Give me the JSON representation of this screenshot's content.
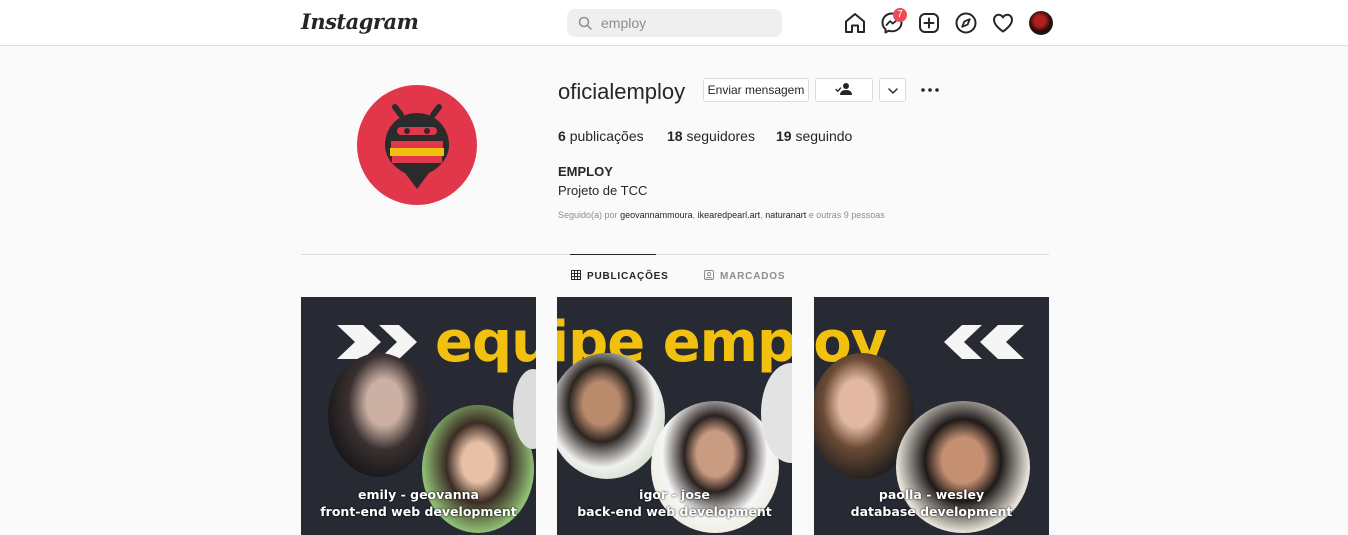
{
  "nav": {
    "logo": "Instagram",
    "search_value": "employ",
    "messenger_badge": "7",
    "icons": [
      "home-icon",
      "messenger-icon",
      "new-post-icon",
      "explore-icon",
      "activity-heart-icon",
      "profile-avatar"
    ]
  },
  "profile": {
    "username": "oficialemploy",
    "message_button": "Enviar mensagem",
    "posts_count": "6",
    "posts_label": "publicações",
    "followers_count": "18",
    "followers_label": "seguidores",
    "following_count": "19",
    "following_label": "seguindo",
    "full_name": "EMPLOY",
    "bio": "Projeto de TCC",
    "followed_by_prefix": "Seguido(a) por",
    "followed_by_names": [
      "geovannammoura",
      "ikearedpearl.art",
      "naturanart"
    ],
    "followed_by_suffix": "e outras 9 pessoas",
    "avatar_color": "#e2374a"
  },
  "tabs": {
    "posts": "PUBLICAÇÕES",
    "tagged": "MARCADOS"
  },
  "posts": [
    {
      "caption_line1": "emily - geovanna",
      "caption_line2": "front-end web development"
    },
    {
      "caption_line1": "igor - jose",
      "caption_line2": "back-end web development"
    },
    {
      "caption_line1": "paolla - wesley",
      "caption_line2": "database development"
    }
  ],
  "banner": {
    "headline": "equipe employ",
    "headline_color": "#f2c10f",
    "background": "#272a33"
  }
}
